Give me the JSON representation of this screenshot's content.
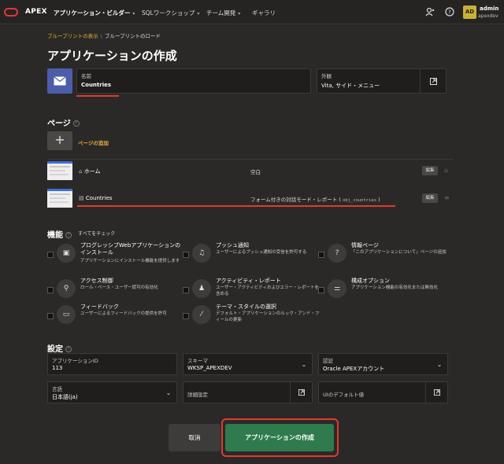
{
  "topbar": {
    "brand": "APEX",
    "nav": [
      {
        "label": "アプリケーション・ビルダー"
      },
      {
        "label": "SQLワークショップ"
      },
      {
        "label": "チーム開発"
      },
      {
        "label": "ギャラリ"
      }
    ],
    "avatar_initials": "AD",
    "user_name": "admin",
    "workspace": "apexdev"
  },
  "breadcrumb": {
    "link": "ブループリントの表示",
    "current": "ブループリントのロード"
  },
  "page_title": "アプリケーションの作成",
  "name_field": {
    "label": "名前",
    "value": "Countries"
  },
  "appearance_field": {
    "label": "外観",
    "value": "Vita, サイド・メニュー"
  },
  "pages_section": {
    "title": "ページ",
    "add_label": "ページの追加",
    "rows": [
      {
        "name": "ホーム",
        "type": "空白",
        "type_code": "",
        "edit": "編集"
      },
      {
        "name": "Countries",
        "type": "フォーム付きの対話モード・レポート (",
        "type_code": "obj_countries",
        "type_end": ")",
        "edit": "編集"
      }
    ]
  },
  "features_section": {
    "title": "機能",
    "check_all": "すべてをチェック",
    "items": [
      {
        "title": "プログレッシブWebアプリケーションのインストール",
        "desc": "アプリケーションにインストール機能を提供します"
      },
      {
        "title": "プッシュ通知",
        "desc": "ユーザーによるプッシュ通知の受信を許可する"
      },
      {
        "title": "情報ページ",
        "desc": "「このアプリケーションについて」ページの追加"
      },
      {
        "title": "アクセス制御",
        "desc": "ロール・ベース・ユーザー認可の有効化"
      },
      {
        "title": "アクティビティ・レポート",
        "desc": "ユーザー・アクティビティおよびエラー・レポートを含める"
      },
      {
        "title": "構成オプション",
        "desc": "アプリケーション機能の有効化または無効化"
      },
      {
        "title": "フィードバック",
        "desc": "ユーザーによるフィードバックの提供を許可"
      },
      {
        "title": "テーマ・スタイルの選択",
        "desc": "デフォルト・アプリケーションのルック・アンド・フィールの更新"
      }
    ]
  },
  "settings_section": {
    "title": "設定",
    "app_id": {
      "label": "アプリケーションID",
      "value": "113"
    },
    "schema": {
      "label": "スキーマ",
      "value": "WKSP_APEXDEV"
    },
    "auth": {
      "label": "認証",
      "value": "Oracle APEXアカウント"
    },
    "language": {
      "label": "言語",
      "value": "日本語(ja)"
    },
    "advanced": {
      "label": "詳細設定"
    },
    "ui_defaults": {
      "label": "UIのデフォルト値"
    }
  },
  "footer": {
    "cancel": "取消",
    "create": "アプリケーションの作成"
  },
  "colors": {
    "accent_red": "#e13a2e",
    "link_gold": "#e7b13a",
    "create_green": "#2f7b4e",
    "app_icon_blue": "#4e5da9"
  }
}
